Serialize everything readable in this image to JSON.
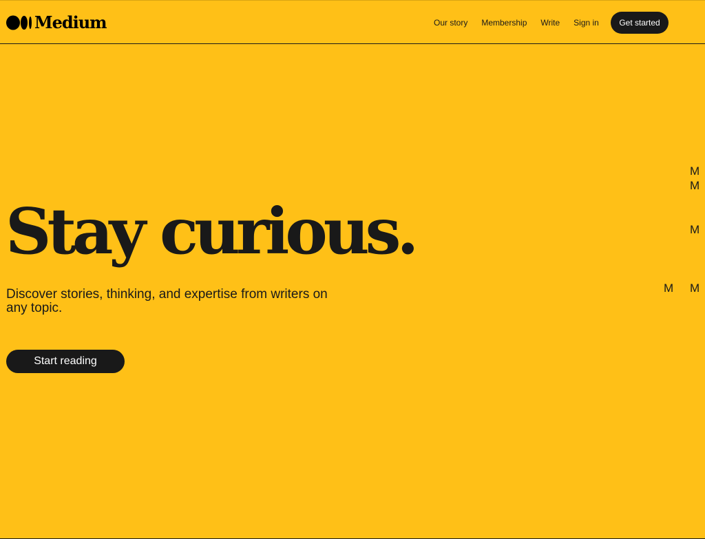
{
  "brand": {
    "name": "Medium"
  },
  "nav": {
    "items": [
      {
        "label": "Our story"
      },
      {
        "label": "Membership"
      },
      {
        "label": "Write"
      },
      {
        "label": "Sign in"
      }
    ],
    "cta_label": "Get started"
  },
  "hero": {
    "title": "Stay curious.",
    "subtitle": "Discover stories, thinking, and expertise from writers on any topic.",
    "cta_label": "Start reading"
  },
  "decorations": {
    "letters": [
      "M",
      "M",
      "M",
      "M",
      "M"
    ]
  },
  "colors": {
    "background": "#ffc017",
    "dark": "#191919",
    "light_text": "#ffffff"
  },
  "icons": {
    "logo": "medium-logo-icon"
  }
}
